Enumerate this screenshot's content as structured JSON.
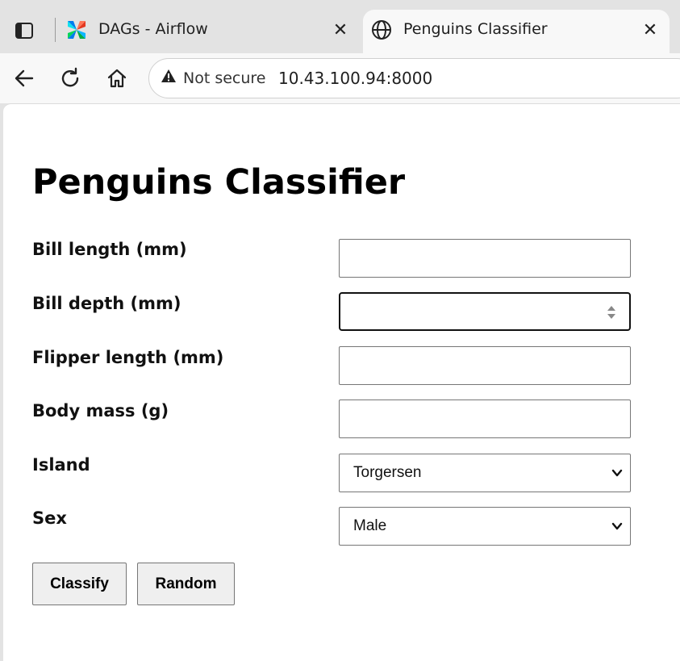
{
  "browser": {
    "tabs": [
      {
        "title": "DAGs - Airflow",
        "favicon": "airflow-icon",
        "active": false
      },
      {
        "title": "Penguins Classifier",
        "favicon": "globe-icon",
        "active": true
      }
    ],
    "address_bar": {
      "security_label": "Not secure",
      "url": "10.43.100.94:8000"
    }
  },
  "page": {
    "title": "Penguins Classifier",
    "fields": {
      "bill_length": {
        "label": "Bill length (mm)",
        "value": ""
      },
      "bill_depth": {
        "label": "Bill depth (mm)",
        "value": ""
      },
      "flipper_length": {
        "label": "Flipper length (mm)",
        "value": ""
      },
      "body_mass": {
        "label": "Body mass (g)",
        "value": ""
      },
      "island": {
        "label": "Island",
        "selected": "Torgersen"
      },
      "sex": {
        "label": "Sex",
        "selected": "Male"
      }
    },
    "buttons": {
      "classify": "Classify",
      "random": "Random"
    }
  }
}
